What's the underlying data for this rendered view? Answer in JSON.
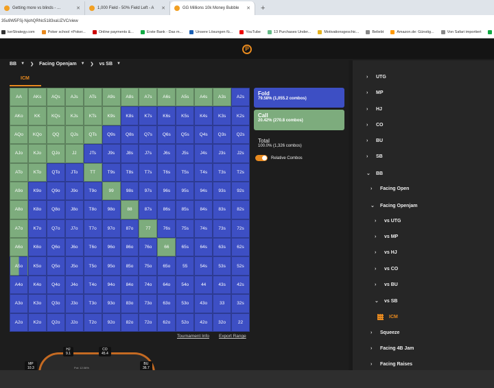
{
  "browser": {
    "tabs": [
      {
        "label": "Getting more vs blinds - ..."
      },
      {
        "label": "1,000 Field - 50% Field Left - A"
      },
      {
        "label": "GG Millions 10k Money Bubble"
      }
    ],
    "new_tab": "+",
    "url": "35u9W5FSj-NjohQRNc5183xaUZVC/view",
    "bookmarks": [
      {
        "label": "kerStrategy.com"
      },
      {
        "label": "Poker school +Poker..."
      },
      {
        "label": "Online payments &..."
      },
      {
        "label": "Erste Bank - Das m..."
      },
      {
        "label": "Unsere Lösungen fü..."
      },
      {
        "label": "YouTube"
      },
      {
        "label": "13 Purchases Under..."
      },
      {
        "label": "Motivationsgeschic..."
      },
      {
        "label": "Beliebt"
      },
      {
        "label": "Amazon.de: Günstig..."
      },
      {
        "label": "Von Safari importiert"
      },
      {
        "label": "alle"
      }
    ]
  },
  "app": {
    "logo_letter": "P"
  },
  "breadcrumb": [
    {
      "label": "BB"
    },
    {
      "label": "Facing Openjam"
    },
    {
      "label": "vs SB"
    }
  ],
  "tab_icm": "ICM",
  "grid": {
    "rows": [
      [
        "AA",
        "AKs",
        "AQs",
        "AJs",
        "ATs",
        "A9s",
        "A8s",
        "A7s",
        "A6s",
        "A5s",
        "A4s",
        "A3s",
        "A2s"
      ],
      [
        "AKo",
        "KK",
        "KQs",
        "KJs",
        "KTs",
        "K9s",
        "K8s",
        "K7s",
        "K6s",
        "K5s",
        "K4s",
        "K3s",
        "K2s"
      ],
      [
        "AQo",
        "KQo",
        "QQ",
        "QJs",
        "QTs",
        "Q9s",
        "Q8s",
        "Q7s",
        "Q6s",
        "Q5s",
        "Q4s",
        "Q3s",
        "Q2s"
      ],
      [
        "AJo",
        "KJo",
        "QJo",
        "JJ",
        "JTs",
        "J9s",
        "J8s",
        "J7s",
        "J6s",
        "J5s",
        "J4s",
        "J3s",
        "J2s"
      ],
      [
        "ATo",
        "KTo",
        "QTo",
        "JTo",
        "TT",
        "T9s",
        "T8s",
        "T7s",
        "T6s",
        "T5s",
        "T4s",
        "T3s",
        "T2s"
      ],
      [
        "A9o",
        "K9o",
        "Q9o",
        "J9o",
        "T9o",
        "99",
        "98s",
        "97s",
        "96s",
        "95s",
        "94s",
        "93s",
        "92s"
      ],
      [
        "A8o",
        "K8o",
        "Q8o",
        "J8o",
        "T8o",
        "98o",
        "88",
        "87s",
        "86s",
        "85s",
        "84s",
        "83s",
        "82s"
      ],
      [
        "A7o",
        "K7o",
        "Q7o",
        "J7o",
        "T7o",
        "97o",
        "87o",
        "77",
        "76s",
        "75s",
        "74s",
        "73s",
        "72s"
      ],
      [
        "A6o",
        "K6o",
        "Q6o",
        "J6o",
        "T6o",
        "96o",
        "86o",
        "76o",
        "66",
        "65s",
        "64s",
        "63s",
        "62s"
      ],
      [
        "A5o",
        "K5o",
        "Q5o",
        "J5o",
        "T5o",
        "95o",
        "85o",
        "75o",
        "65o",
        "55",
        "54s",
        "53s",
        "52s"
      ],
      [
        "A4o",
        "K4o",
        "Q4o",
        "J4o",
        "T4o",
        "94o",
        "84o",
        "74o",
        "64o",
        "54o",
        "44",
        "43s",
        "42s"
      ],
      [
        "A3o",
        "K3o",
        "Q3o",
        "J3o",
        "T3o",
        "93o",
        "83o",
        "73o",
        "63o",
        "53o",
        "43o",
        "33",
        "32s"
      ],
      [
        "A2o",
        "K2o",
        "Q2o",
        "J2o",
        "T2o",
        "92o",
        "82o",
        "72o",
        "62o",
        "52o",
        "42o",
        "32o",
        "22"
      ]
    ],
    "call_counts": [
      [
        12,
        12,
        12,
        12,
        12,
        12,
        12,
        12,
        12,
        12,
        12,
        12,
        0
      ],
      [
        12,
        12,
        12,
        12,
        12,
        12,
        0,
        0,
        0,
        0,
        0,
        0,
        0
      ],
      [
        12,
        12,
        12,
        12,
        12,
        0,
        0,
        0,
        0,
        0,
        0,
        0,
        0
      ],
      [
        12,
        12,
        12,
        12,
        0,
        0,
        0,
        0,
        0,
        0,
        0,
        0,
        0
      ],
      [
        12,
        12,
        0,
        0,
        12,
        0,
        0,
        0,
        0,
        0,
        0,
        0,
        0
      ],
      [
        12,
        0,
        0,
        0,
        0,
        12,
        0,
        0,
        0,
        0,
        0,
        0,
        0
      ],
      [
        12,
        0,
        0,
        0,
        0,
        0,
        12,
        0,
        0,
        0,
        0,
        0,
        0
      ],
      [
        12,
        0,
        0,
        0,
        0,
        0,
        0,
        12,
        0,
        0,
        0,
        0,
        0
      ],
      [
        12,
        0,
        0,
        0,
        0,
        0,
        0,
        0,
        12,
        0,
        0,
        0,
        0
      ],
      [
        6,
        0,
        0,
        0,
        0,
        0,
        0,
        0,
        0,
        0,
        0,
        0,
        0
      ],
      [
        0,
        0,
        0,
        0,
        0,
        0,
        0,
        0,
        0,
        0,
        0,
        0,
        0
      ],
      [
        0,
        0,
        0,
        0,
        0,
        0,
        0,
        0,
        0,
        0,
        0,
        0,
        0
      ],
      [
        0,
        0,
        0,
        0,
        0,
        0,
        0,
        0,
        0,
        0,
        0,
        0,
        0
      ]
    ],
    "colors": {
      "fold": "#3d4fc4",
      "call": "#7dac7d"
    }
  },
  "legend": {
    "fold": {
      "name": "Fold",
      "value": "79.58% (1,055.2 combos)"
    },
    "call": {
      "name": "Call",
      "value": "20.42% (270.8 combos)"
    },
    "total": {
      "name": "Total",
      "value": "100.0% (1,326 combos)"
    },
    "relative_combos": "Relative Combos"
  },
  "links": {
    "tournament_info": "Tournament Info",
    "export_range": "Export Range"
  },
  "table": {
    "seats": [
      {
        "pos": "HJ",
        "stack": "9.1"
      },
      {
        "pos": "CO",
        "stack": "45.4"
      },
      {
        "pos": "MP",
        "stack": "10.3"
      },
      {
        "pos": "BU",
        "stack": "36.7"
      }
    ],
    "pot": "Pot: 12.06%"
  },
  "tree": [
    {
      "label": "UTG",
      "level": 0,
      "open": false
    },
    {
      "label": "MP",
      "level": 0,
      "open": false
    },
    {
      "label": "HJ",
      "level": 0,
      "open": false
    },
    {
      "label": "CO",
      "level": 0,
      "open": false
    },
    {
      "label": "BU",
      "level": 0,
      "open": false
    },
    {
      "label": "SB",
      "level": 0,
      "open": false
    },
    {
      "label": "BB",
      "level": 0,
      "open": true
    },
    {
      "label": "Facing Open",
      "level": 1,
      "open": false
    },
    {
      "label": "Facing Openjam",
      "level": 1,
      "open": true
    },
    {
      "label": "vs UTG",
      "level": 2,
      "open": false
    },
    {
      "label": "vs MP",
      "level": 2,
      "open": false
    },
    {
      "label": "vs HJ",
      "level": 2,
      "open": false
    },
    {
      "label": "vs CO",
      "level": 2,
      "open": false
    },
    {
      "label": "vs BU",
      "level": 2,
      "open": false
    },
    {
      "label": "vs SB",
      "level": 2,
      "open": true
    },
    {
      "label": "ICM",
      "level": 3,
      "open": false,
      "selected": true
    },
    {
      "label": "Squeeze",
      "level": 1,
      "open": false
    },
    {
      "label": "Facing 4B Jam",
      "level": 1,
      "open": false
    },
    {
      "label": "Facing Raises",
      "level": 1,
      "open": false
    }
  ]
}
